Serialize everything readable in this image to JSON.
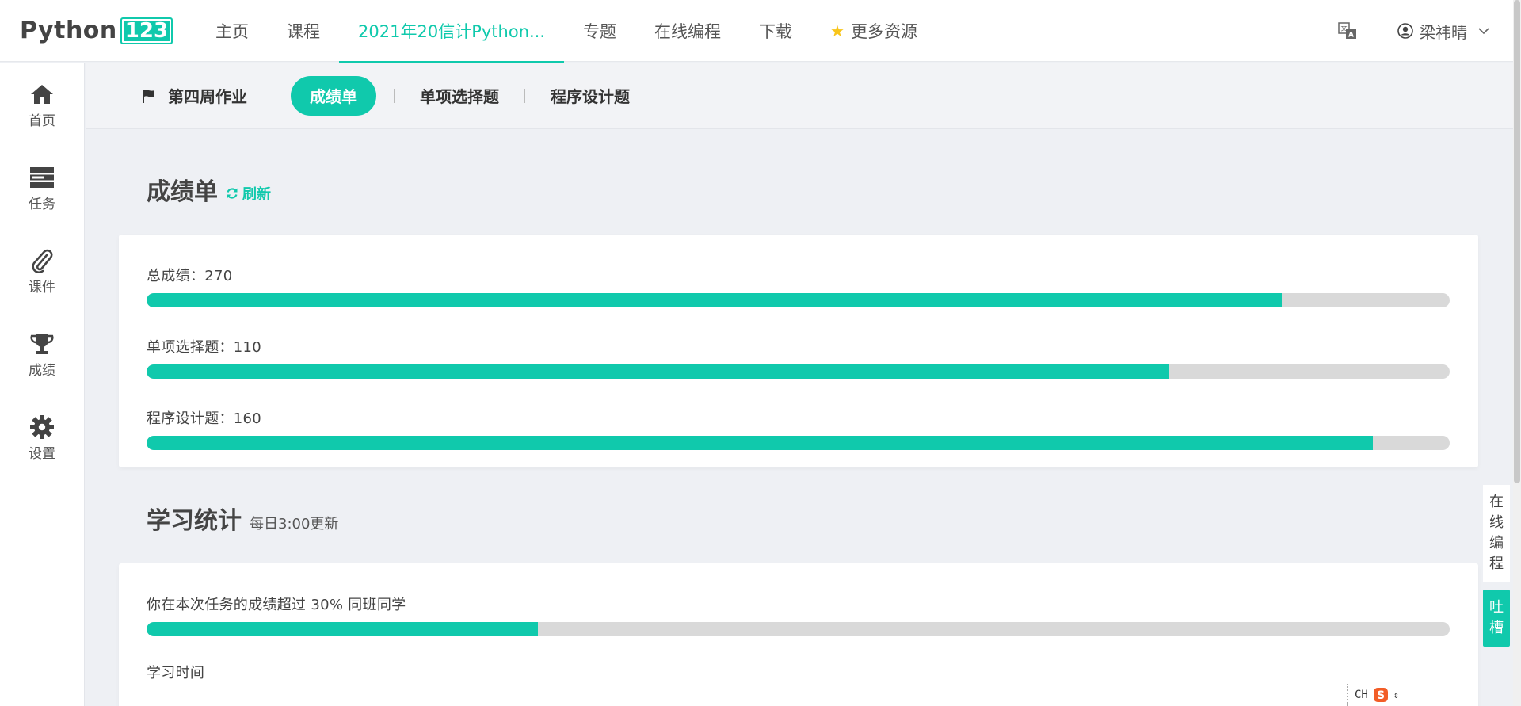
{
  "logo": {
    "text": "Python",
    "badge": "123"
  },
  "nav": [
    {
      "label": "主页"
    },
    {
      "label": "课程"
    },
    {
      "label": "2021年20信计Python..."
    },
    {
      "label": "专题"
    },
    {
      "label": "在线编程"
    },
    {
      "label": "下载"
    },
    {
      "label": "更多资源"
    }
  ],
  "user": {
    "name": "梁祎晴"
  },
  "sidebar": {
    "items": [
      {
        "label": "首页",
        "icon": "home-icon"
      },
      {
        "label": "任务",
        "icon": "tasks-icon"
      },
      {
        "label": "课件",
        "icon": "paperclip-icon"
      },
      {
        "label": "成绩",
        "icon": "trophy-icon"
      },
      {
        "label": "设置",
        "icon": "gear-icon"
      }
    ]
  },
  "subtabs": [
    {
      "label": "第四周作业"
    },
    {
      "label": "成绩单"
    },
    {
      "label": "单项选择题"
    },
    {
      "label": "程序设计题"
    }
  ],
  "scores": {
    "title": "成绩单",
    "refresh_label": "刷新",
    "rows": [
      {
        "label": "总成绩：270",
        "fraction": 0.871
      },
      {
        "label": "单项选择题：110",
        "fraction": 0.785
      },
      {
        "label": "程序设计题：160",
        "fraction": 0.941
      }
    ]
  },
  "stats": {
    "title": "学习统计",
    "note": "每日3:00更新",
    "rank_label": "你在本次任务的成绩超过 30% 同班同学",
    "rank_fraction": 0.3,
    "time_label": "学习时间"
  },
  "float": {
    "online_coding": [
      "在",
      "线",
      "编",
      "程"
    ],
    "feedback": [
      "吐",
      "槽"
    ]
  },
  "ime": {
    "label": "CH"
  },
  "colors": {
    "accent": "#10c9ac",
    "track": "#d9d9d9"
  }
}
